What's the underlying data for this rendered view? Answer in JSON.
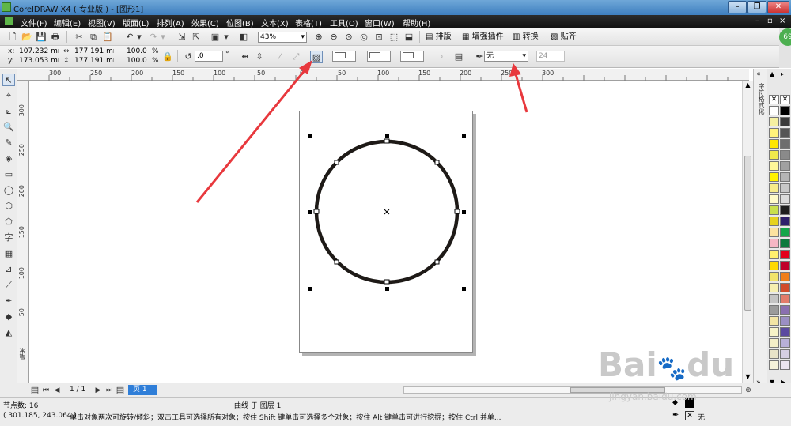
{
  "window": {
    "title": "CorelDRAW X4 ( 专业版 ) - [图形1]",
    "min": "–",
    "restore": "❐",
    "close": "✕"
  },
  "menu": [
    "文件(F)",
    "编辑(E)",
    "视图(V)",
    "版面(L)",
    "排列(A)",
    "效果(C)",
    "位图(B)",
    "文本(X)",
    "表格(T)",
    "工具(O)",
    "窗口(W)",
    "帮助(H)"
  ],
  "toolbar": {
    "zoom": "43%",
    "btn_paiban": "排版",
    "btn_plugin": "增强插件",
    "btn_convert": "转换",
    "btn_paste": "贴齐",
    "badge": "69"
  },
  "props": {
    "x": "107.232 mm",
    "y": "173.053 mm",
    "w": "177.191 mm",
    "h": "177.191 mm",
    "sx": "100.0",
    "sy": "100.0",
    "pct": "%",
    "angle": ".0",
    "deg": "°",
    "outline_label": "无",
    "num_field": "24",
    "x_label": "x:",
    "y_label": "y:"
  },
  "ruler": {
    "h_ticks": [
      "300",
      "250",
      "200",
      "150",
      "100",
      "50",
      "0",
      "50",
      "100",
      "150",
      "200",
      "250",
      "300"
    ],
    "v_ticks": [
      "300",
      "250",
      "200",
      "150",
      "100",
      "50"
    ],
    "units_left": "毫米"
  },
  "docker": {
    "label": "对象属性",
    "tab": "字符格式化"
  },
  "palette": {
    "colors": [
      "#ffffff",
      "#000000",
      "#f5f0a0",
      "#3b3b3b",
      "#fff27a",
      "#555555",
      "#ffe600",
      "#6e6e6e",
      "#f0e84b",
      "#8a8a8a",
      "#fff799",
      "#a0a0a0",
      "#fff200",
      "#b5b5b5",
      "#f7ec8a",
      "#c8c8c8",
      "#fffbc8",
      "#dcdcdc",
      "#c9e04c",
      "#1e1e1e",
      "#e6d21e",
      "#2e1f6b",
      "#fbe2a0",
      "#14a64a",
      "#f6b6c4",
      "#0f7a3e",
      "#fff06e",
      "#e3001b",
      "#ffd900",
      "#c0002a",
      "#f2e36a",
      "#ef7f1a",
      "#f6efb0",
      "#d24b2a",
      "#c4c4c4",
      "#e27b6a",
      "#9b9b9b",
      "#8a6fb0",
      "#f3e5a4",
      "#9b8fc3",
      "#f7f3c8",
      "#5b4aa0",
      "#f3eec8",
      "#b8b0d8",
      "#e8e3c8",
      "#d6cfe3",
      "#f6f3da",
      "#ebe6ef"
    ]
  },
  "pagebar": {
    "page_count": "1 / 1",
    "page_tab": "页 1"
  },
  "status": {
    "nodes": "节点数: 16",
    "layer": "曲线 于 图层 1",
    "coords": "( 301.185, 243.064 )",
    "hint": "单击对象两次可旋转/倾斜；双击工具可选择所有对象；按住 Shift 键单击可选择多个对象；按住 Alt 键单击可进行挖掘；按住 Ctrl 并单...",
    "fill_none": "无"
  },
  "watermark": {
    "brand": "Bai",
    "brand2": "du",
    "cn": "经验",
    "url": "jingyan.baidu.com"
  },
  "colors": {
    "arrow": "#e8383d",
    "menubar": "#1a1a1a",
    "circle": "#1e1a17",
    "page_tab": "#2f7ed8"
  }
}
